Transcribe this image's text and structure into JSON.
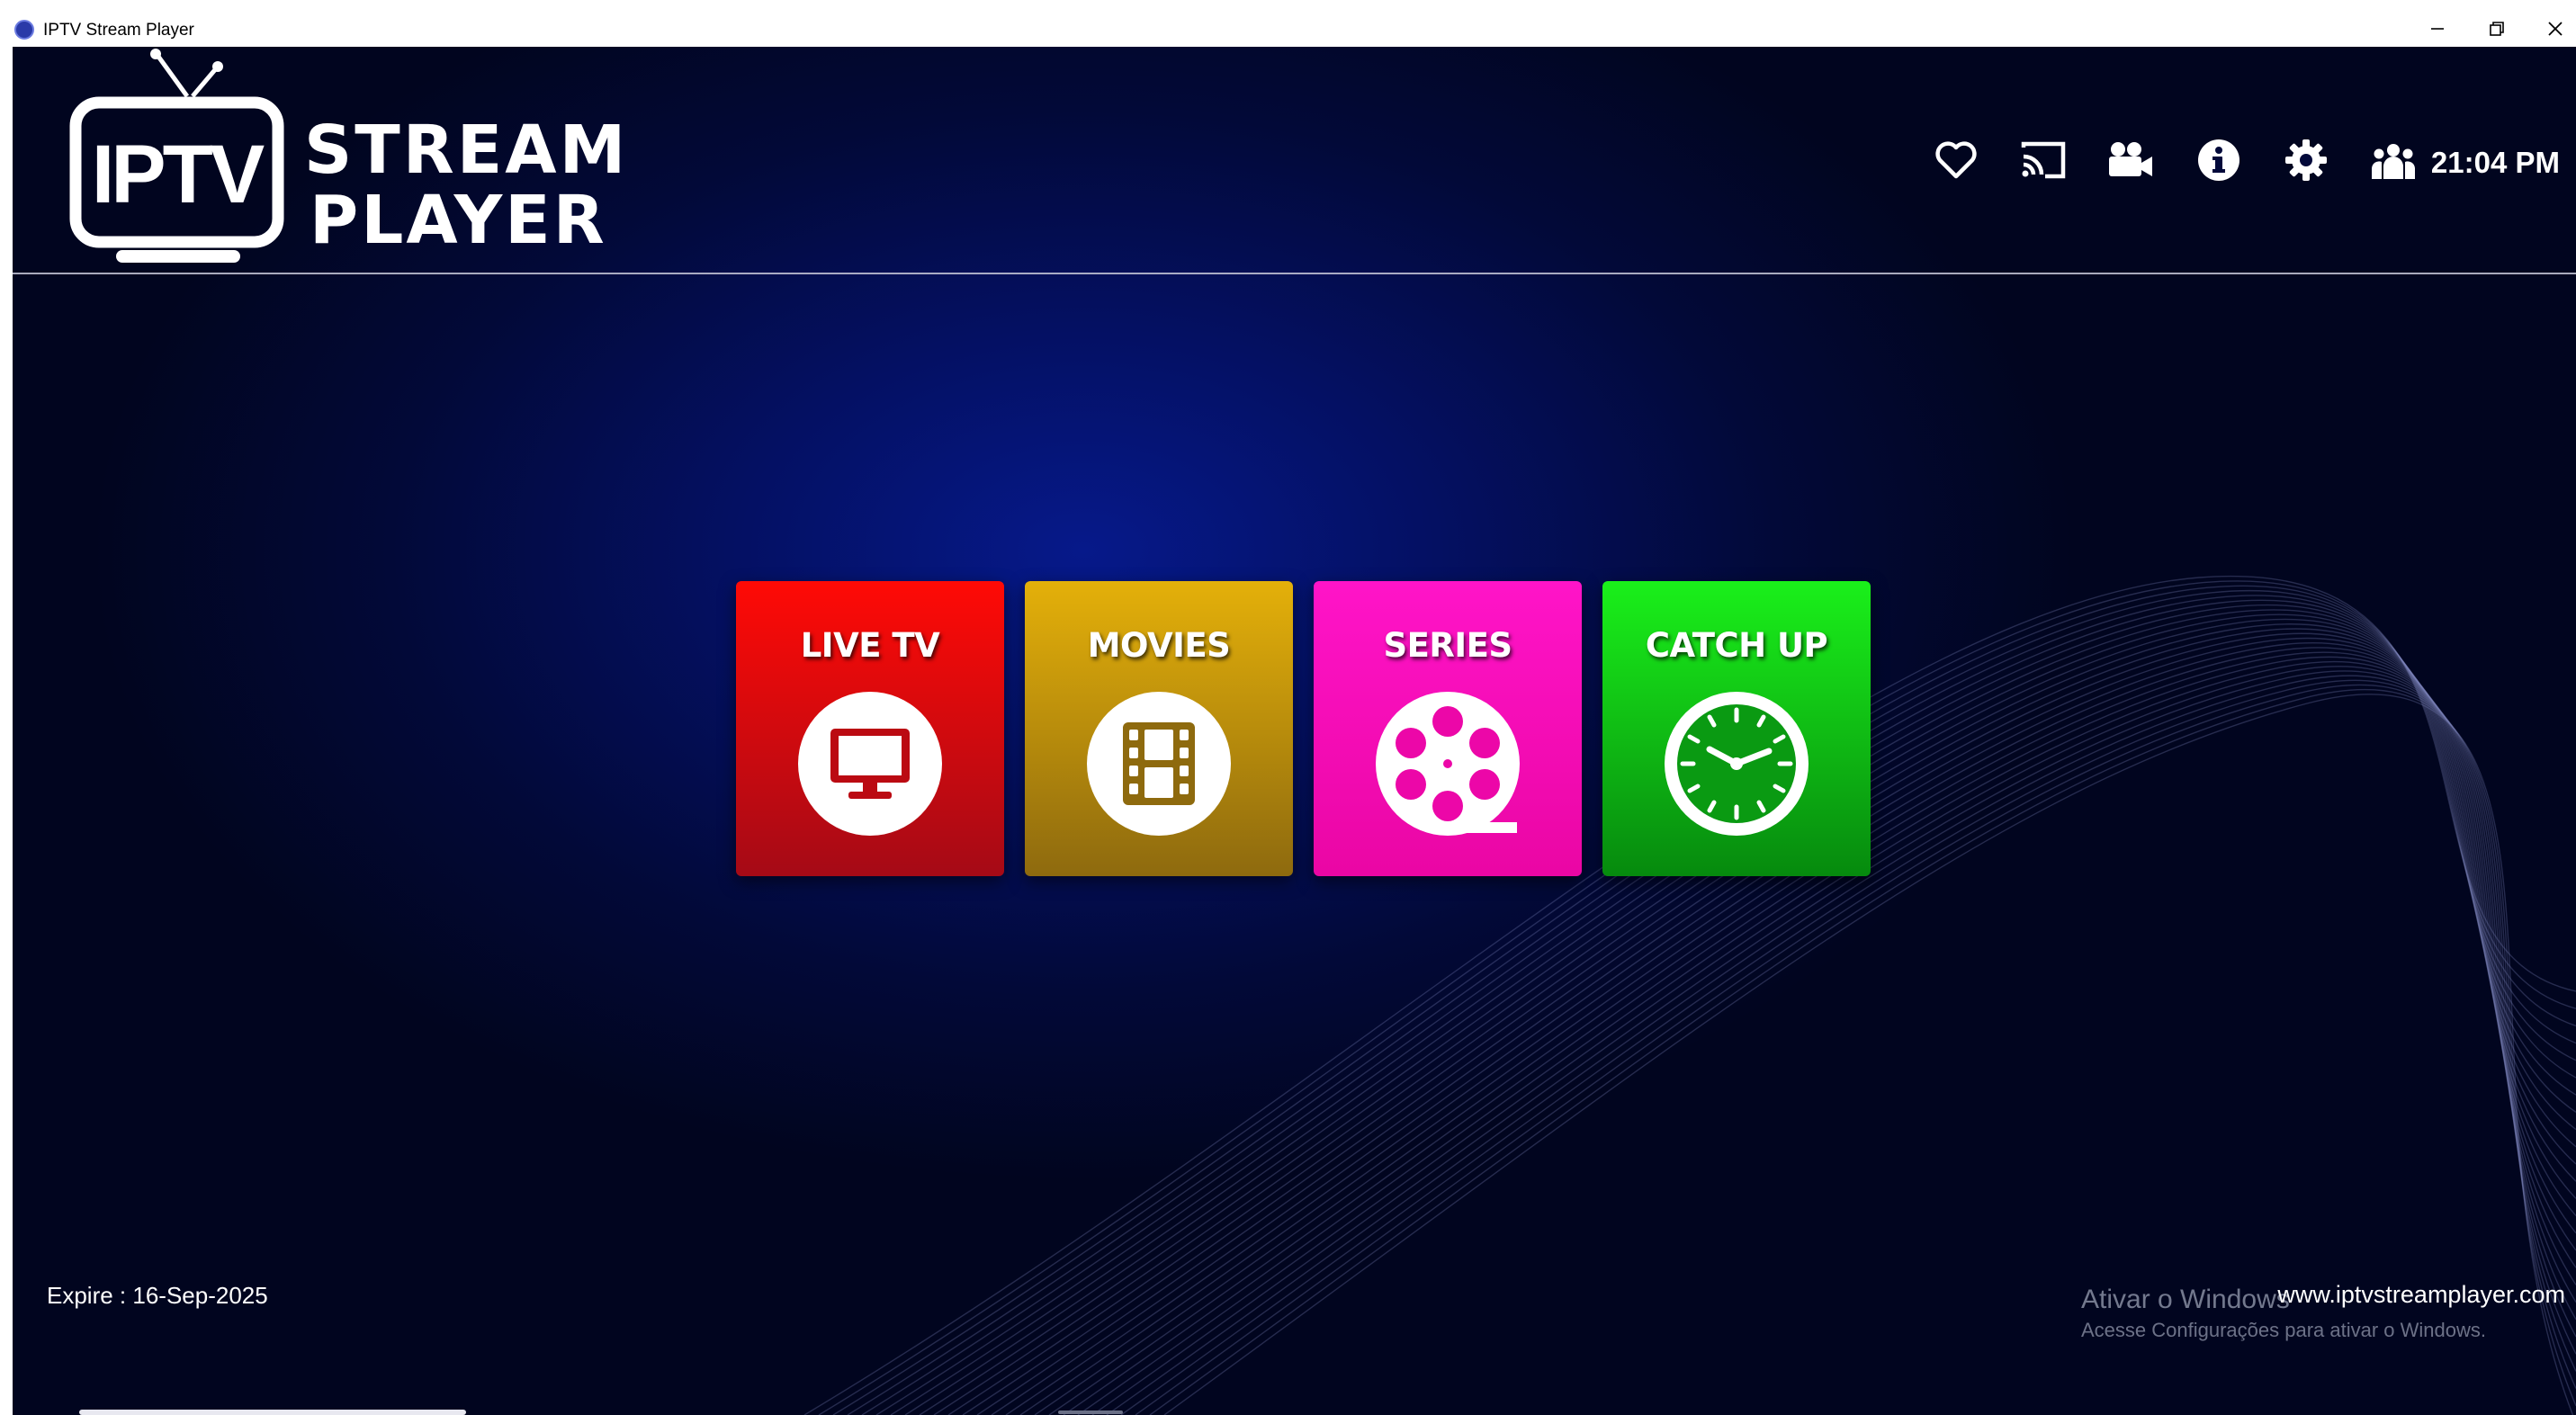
{
  "window": {
    "title": "IPTV Stream Player",
    "controls": [
      "minimize",
      "restore",
      "close"
    ]
  },
  "logo": {
    "badge_text": "IPTV",
    "line1": "STREAM",
    "line2": "PLAYER"
  },
  "header": {
    "icons": [
      "heart-icon",
      "cast-icon",
      "video-camera-icon",
      "info-icon",
      "gear-icon",
      "users-icon"
    ],
    "time": "21:04 PM"
  },
  "tiles": [
    {
      "label": "LIVE TV",
      "icon": "tv-icon",
      "color_top": "#ff0a06",
      "color_bottom": "#a50a16"
    },
    {
      "label": "MOVIES",
      "icon": "film-strip-icon",
      "color_top": "#e4b00a",
      "color_bottom": "#8e6a0e"
    },
    {
      "label": "SERIES",
      "icon": "film-reel-icon",
      "color_top": "#ff14c8",
      "color_bottom": "#ea06a4"
    },
    {
      "label": "CATCH UP",
      "icon": "clock-icon",
      "color_top": "#1af01a",
      "color_bottom": "#068a0e"
    }
  ],
  "footer": {
    "expire": "Expire : 16-Sep-2025",
    "website": "www.iptvstreamplayer.com"
  },
  "windows_activation": {
    "title": "Ativar o Windows",
    "subtitle": "Acesse Configurações para ativar o Windows."
  }
}
